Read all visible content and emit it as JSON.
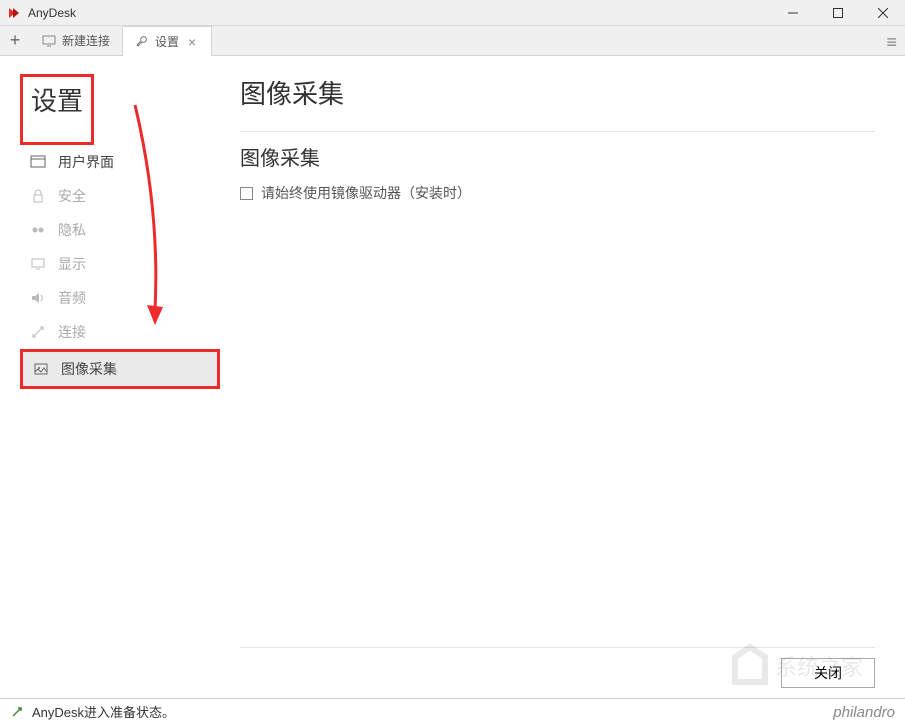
{
  "titlebar": {
    "title": "AnyDesk"
  },
  "tabs": {
    "new_connection": "新建连接",
    "settings": "设置"
  },
  "sidebar": {
    "title": "设置",
    "items": [
      {
        "label": "用户界面"
      },
      {
        "label": "安全"
      },
      {
        "label": "隐私"
      },
      {
        "label": "显示"
      },
      {
        "label": "音频"
      },
      {
        "label": "连接"
      },
      {
        "label": "图像采集"
      }
    ]
  },
  "main": {
    "title": "图像采集",
    "section_title": "图像采集",
    "checkbox_label": "请始终使用镜像驱动器（安装时）",
    "close_button": "关闭"
  },
  "statusbar": {
    "text": "AnyDesk进入准备状态。",
    "brand": "philandro"
  },
  "watermark_text": "系统之家"
}
